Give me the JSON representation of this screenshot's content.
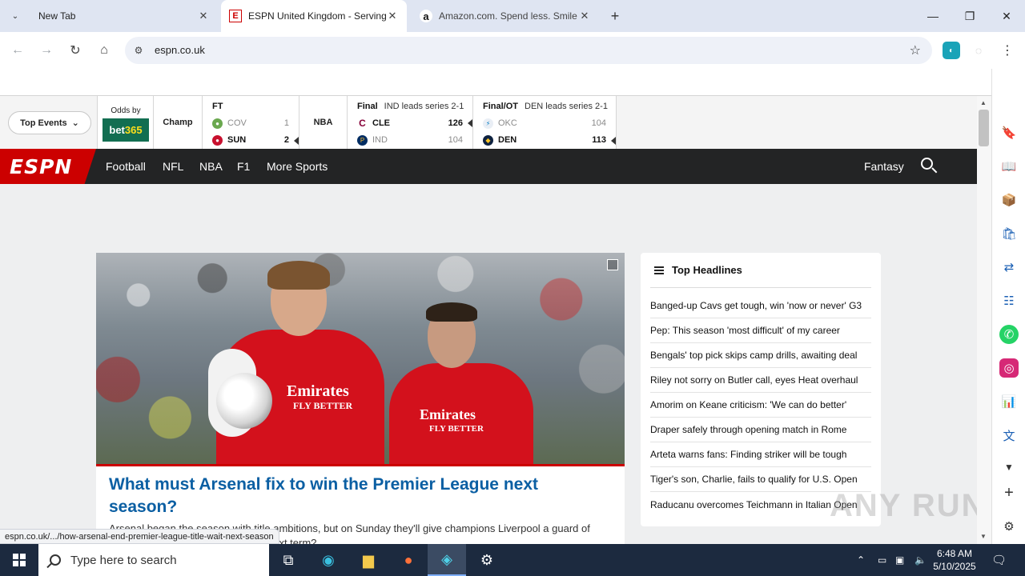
{
  "browser": {
    "tabs": [
      {
        "label": "New Tab",
        "active": false
      },
      {
        "label": "ESPN United Kingdom - Serving",
        "active": true,
        "favicon": "E"
      },
      {
        "label": "Amazon.com. Spend less. Smile",
        "active": false,
        "favicon": "a"
      }
    ],
    "url": "espn.co.uk",
    "status_url": "espn.co.uk/.../how-arsenal-end-premier-league-title-wait-next-season"
  },
  "scoreboard": {
    "top_events_label": "Top Events",
    "odds_by_label": "Odds by",
    "sponsor": {
      "left": "bet",
      "right": "365"
    },
    "leagues": [
      "Champ",
      "NBA"
    ],
    "games": [
      {
        "status": "FT",
        "note": "",
        "teams": [
          {
            "abbr": "COV",
            "score": "1",
            "winner": false
          },
          {
            "abbr": "SUN",
            "score": "2",
            "winner": true
          }
        ]
      },
      {
        "status": "Final",
        "note": "IND leads series 2-1",
        "teams": [
          {
            "abbr": "CLE",
            "score": "126",
            "winner": true
          },
          {
            "abbr": "IND",
            "score": "104",
            "winner": false
          }
        ]
      },
      {
        "status": "Final/OT",
        "note": "DEN leads series 2-1",
        "teams": [
          {
            "abbr": "OKC",
            "score": "104",
            "winner": false
          },
          {
            "abbr": "DEN",
            "score": "113",
            "winner": true
          }
        ]
      }
    ]
  },
  "nav": {
    "logo": "ESPN",
    "links": [
      "Football",
      "NFL",
      "NBA",
      "F1",
      "More Sports"
    ],
    "fantasy": "Fantasy"
  },
  "hero": {
    "shirt_sponsor_1": "Emirates",
    "shirt_sponsor_2": "FLY BETTER",
    "headline": "What must Arsenal fix to win the Premier League next season?",
    "description": "Arsenal began the season with title ambitions, but on Sunday they'll give champions Liverpool a guard of honour. What must they fix before next term?"
  },
  "top_headlines": {
    "title": "Top Headlines",
    "items": [
      "Banged-up Cavs get tough, win 'now or never' G3",
      "Pep: This season 'most difficult' of my career",
      "Bengals' top pick skips camp drills, awaiting deal",
      "Riley not sorry on Butler call, eyes Heat overhaul",
      "Amorim on Keane criticism: 'We can do better'",
      "Draper safely through opening match in Rome",
      "Arteta warns fans: Finding striker will be tough",
      "Tiger's son, Charlie, fails to qualify for U.S. Open",
      "Raducanu overcomes Teichmann in Italian Open"
    ]
  },
  "watermark": "ANY RUN",
  "taskbar": {
    "search_placeholder": "Type here to search",
    "time": "6:48 AM",
    "date": "5/10/2025"
  },
  "colors": {
    "espn_red": "#cc0000",
    "nav_dark": "#232425",
    "headline_blue": "#0b5fa3",
    "bet365_green": "#126e51",
    "bet365_yellow": "#ffdf1b"
  }
}
